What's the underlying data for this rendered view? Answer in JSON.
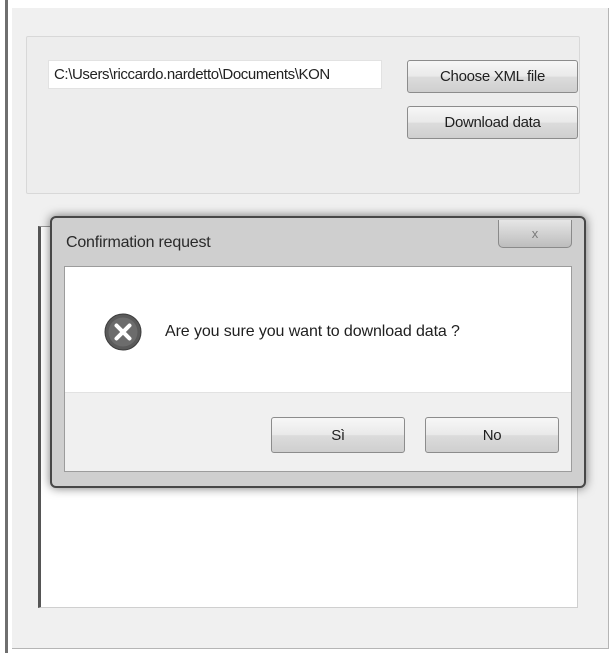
{
  "main": {
    "file_path_value": "C:\\Users\\riccardo.nardetto\\Documents\\KON",
    "choose_button_label": "Choose XML file",
    "download_button_label": "Download data"
  },
  "dialog": {
    "title": "Confirmation request",
    "close_label": "x",
    "icon": "error-x-icon",
    "message": "Are you sure you want to download data ?",
    "yes_label": "Sì",
    "no_label": "No"
  },
  "colors": {
    "window_background": "#f0f0f0",
    "dialog_border": "#474747",
    "icon_fill": "#5a5a5a"
  }
}
